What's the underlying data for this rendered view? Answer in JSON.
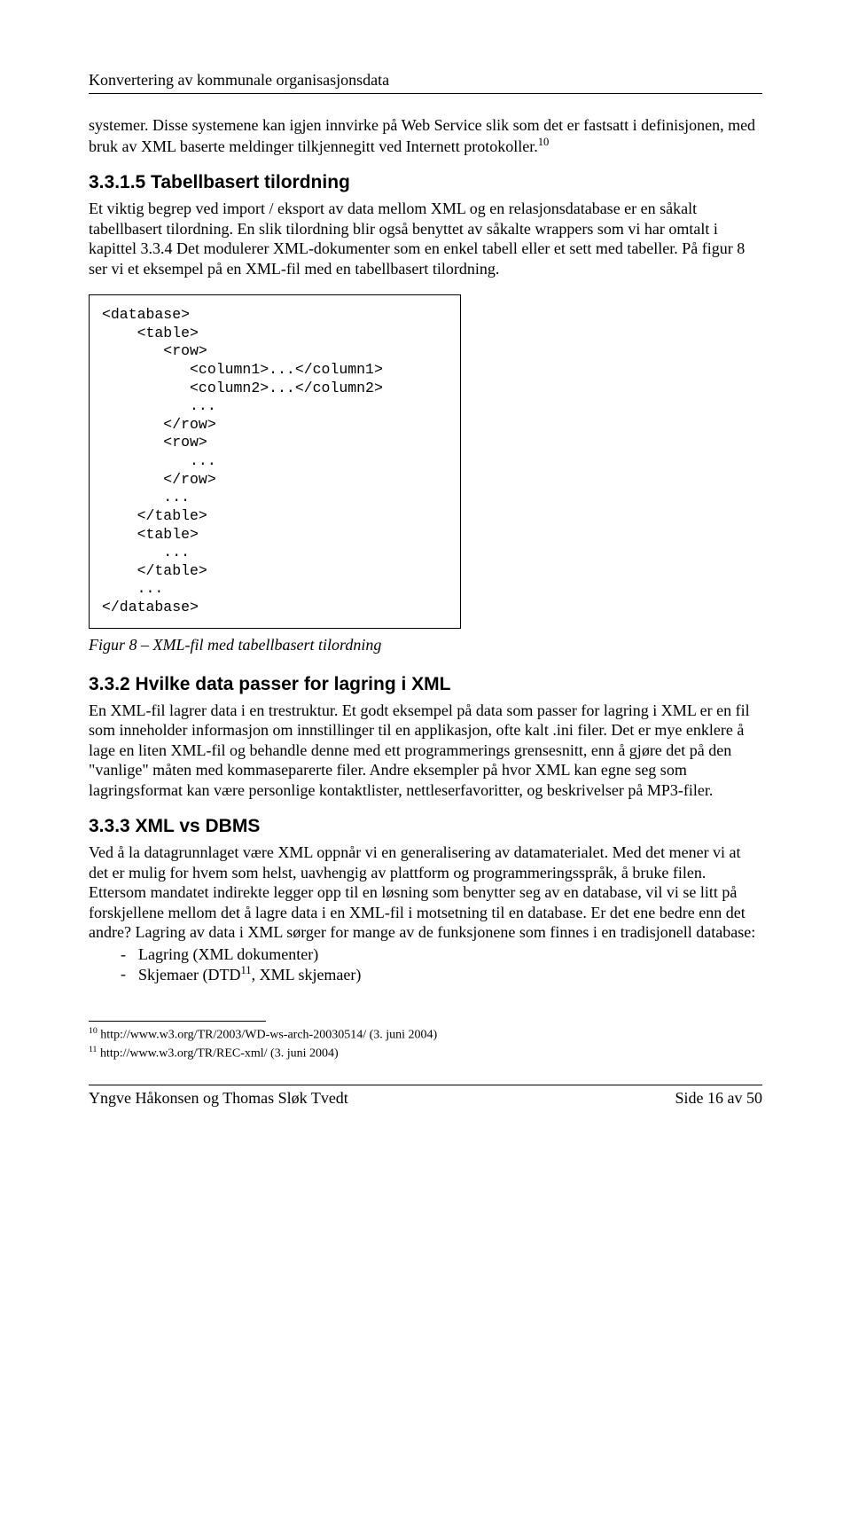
{
  "header": "Konvertering av kommunale organisasjonsdata",
  "para1": "systemer. Disse systemene kan igjen innvirke på Web Service slik som det er fastsatt i definisjonen, med bruk av XML baserte meldinger tilkjennegitt ved Internett protokoller.",
  "para1_sup": "10",
  "sec315_title": "3.3.1.5 Tabellbasert tilordning",
  "sec315_body": "Et viktig begrep ved import / eksport av data mellom XML og en relasjonsdatabase er en såkalt tabellbasert tilordning. En slik tilordning blir også benyttet av såkalte wrappers som vi har omtalt i kapittel 3.3.4 Det modulerer XML-dokumenter som en enkel tabell eller et sett med tabeller. På figur 8 ser vi et eksempel på en XML-fil med en tabellbasert tilordning.",
  "code": "<database>\n    <table>\n       <row>\n          <column1>...</column1>\n          <column2>...</column2>\n          ...\n       </row>\n       <row>\n          ...\n       </row>\n       ...\n    </table>\n    <table>\n       ...\n    </table>\n    ...\n</database>",
  "fig_caption": "Figur 8 – XML-fil med tabellbasert tilordning",
  "sec332_title": "3.3.2 Hvilke data passer for lagring i XML",
  "sec332_body": "En XML-fil lagrer data i en trestruktur. Et godt eksempel på data som passer for lagring i XML er en fil som inneholder informasjon om innstillinger til en applikasjon, ofte kalt .ini filer. Det er mye enklere å lage en liten XML-fil og behandle denne med ett programmerings grensesnitt, enn å gjøre det på den \"vanlige\" måten med kommaseparerte filer. Andre eksempler på hvor XML kan egne seg som lagringsformat kan være personlige kontaktlister, nettleserfavoritter, og beskrivelser på MP3-filer.",
  "sec333_title": "3.3.3 XML vs DBMS",
  "sec333_p1": "Ved å la datagrunnlaget være XML oppnår vi en generalisering av datamaterialet. Med det mener vi at det er mulig for hvem som helst, uavhengig av plattform og programmeringsspråk, å bruke filen.",
  "sec333_p2": "Ettersom mandatet indirekte legger opp til en løsning som benytter seg av en database, vil vi se litt på forskjellene mellom det å lagre data i en XML-fil i motsetning til en database. Er det ene bedre enn det andre? Lagring av data i XML sørger for mange av de funksjonene som finnes i en tradisjonell database:",
  "list": {
    "item1": "Lagring (XML dokumenter)",
    "item2_a": "Skjemaer (DTD",
    "item2_sup": "11",
    "item2_b": ", XML skjemaer)"
  },
  "footnotes": {
    "f10_num": "10",
    "f10_text": " http://www.w3.org/TR/2003/WD-ws-arch-20030514/ (3. juni 2004)",
    "f11_num": "11",
    "f11_text": " http://www.w3.org/TR/REC-xml/ (3. juni 2004)"
  },
  "footer": {
    "left": "Yngve Håkonsen og Thomas Sløk Tvedt",
    "right": "Side 16 av 50"
  }
}
